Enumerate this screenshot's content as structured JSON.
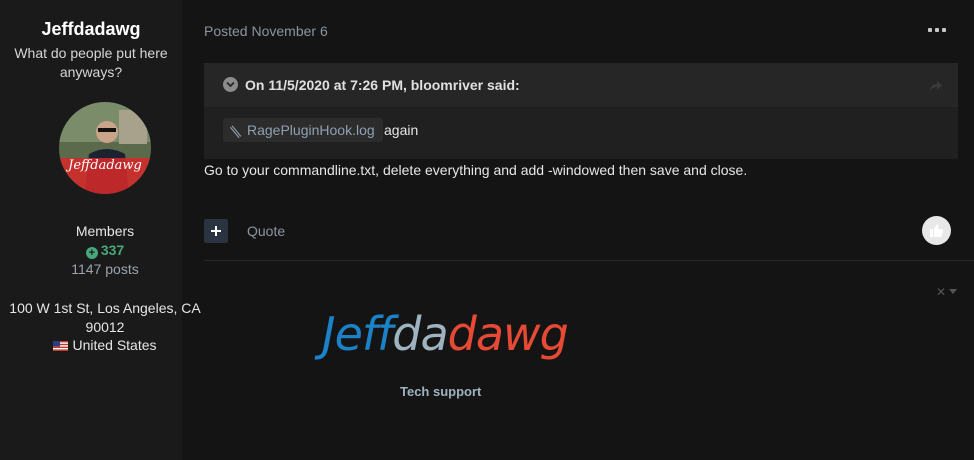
{
  "author": {
    "name": "Jeffdadawg",
    "tagline": "What do people put here anyways?",
    "avatar_text": "Jeffdadawg",
    "group": "Members",
    "reputation": "337",
    "posts": "1147 posts",
    "location": "100 W 1st St, Los Angeles, CA 90012",
    "country": "United States"
  },
  "post": {
    "posted": "Posted November 6",
    "quote": {
      "citation": "On 11/5/2020 at 7:26 PM, bloomriver said:",
      "attachment": "RagePluginHook.log",
      "after_text": "again"
    },
    "text": "Go to your commandline.txt, delete everything and add -windowed then save and close.",
    "quote_link": "Quote"
  },
  "signature": {
    "logo_part1": "Jeff",
    "logo_part2": "da",
    "logo_part3": "dawg",
    "subtitle": "Tech support"
  },
  "colors": {
    "reputation": "#47a87b",
    "logo_blue": "#1c82c8",
    "logo_grey": "#9eb3bf",
    "logo_red": "#e64a35",
    "background": "#141414"
  },
  "icons": [
    "plus-circle-icon",
    "us-flag-icon",
    "more-icon",
    "chevron-down-icon",
    "share-icon",
    "paperclip-icon",
    "plus-icon",
    "thumbs-up-icon",
    "close-icon",
    "caret-down-icon"
  ]
}
